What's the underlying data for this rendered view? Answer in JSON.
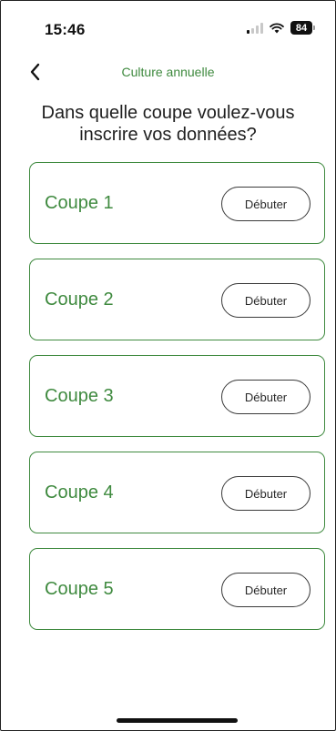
{
  "status_bar": {
    "time": "15:46",
    "battery": "84"
  },
  "nav": {
    "title": "Culture annuelle",
    "back_icon": "chevron-left-icon"
  },
  "heading": "Dans quelle coupe voulez-vous inscrire vos données?",
  "cards": [
    {
      "label": "Coupe 1",
      "button": "Débuter"
    },
    {
      "label": "Coupe 2",
      "button": "Débuter"
    },
    {
      "label": "Coupe 3",
      "button": "Débuter"
    },
    {
      "label": "Coupe 4",
      "button": "Débuter"
    },
    {
      "label": "Coupe 5",
      "button": "Débuter"
    }
  ],
  "colors": {
    "accent": "#3f8a3f",
    "button_border": "#3a3a3a"
  }
}
